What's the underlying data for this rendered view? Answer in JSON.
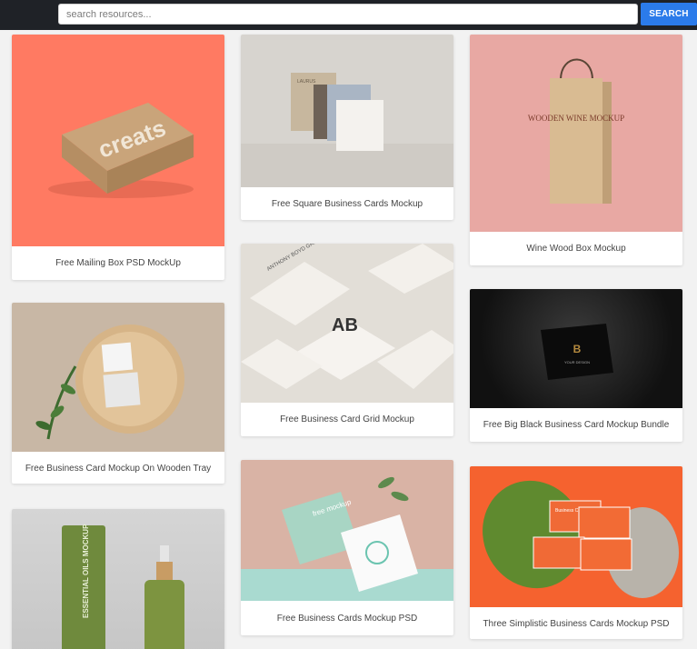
{
  "search": {
    "placeholder": "search resources...",
    "button_label": "SEARCH"
  },
  "cards": [
    {
      "caption": "Free Mailing Box PSD MockUp",
      "box_text": "creats"
    },
    {
      "caption": "Free Business Card Mockup On Wooden Tray"
    },
    {
      "caption": "",
      "bottle_label": "ESSENTIAL OILS MOCKUP"
    },
    {
      "caption": "Free Square Business Cards Mockup",
      "card_text": "LAURUS"
    },
    {
      "caption": "Free Business Card Grid Mockup",
      "brand_text": "ANTHONY BOYD GRAPHICS"
    },
    {
      "caption": "Free Business Cards Mockup PSD",
      "card_text": "free mockup"
    },
    {
      "caption": "Wine Wood Box Mockup",
      "box_text": "WOODEN WINE MOCKUP"
    },
    {
      "caption": "Free Big Black Business Card Mockup Bundle",
      "card_text": "YOUR DESIGN"
    },
    {
      "caption": "Three Simplistic Business Cards Mockup PSD",
      "card_text": "Business Card Mockup"
    }
  ],
  "colors": {
    "topbar": "#1f2227",
    "search_button": "#2b7bea",
    "page_background": "#f2f2f2"
  }
}
